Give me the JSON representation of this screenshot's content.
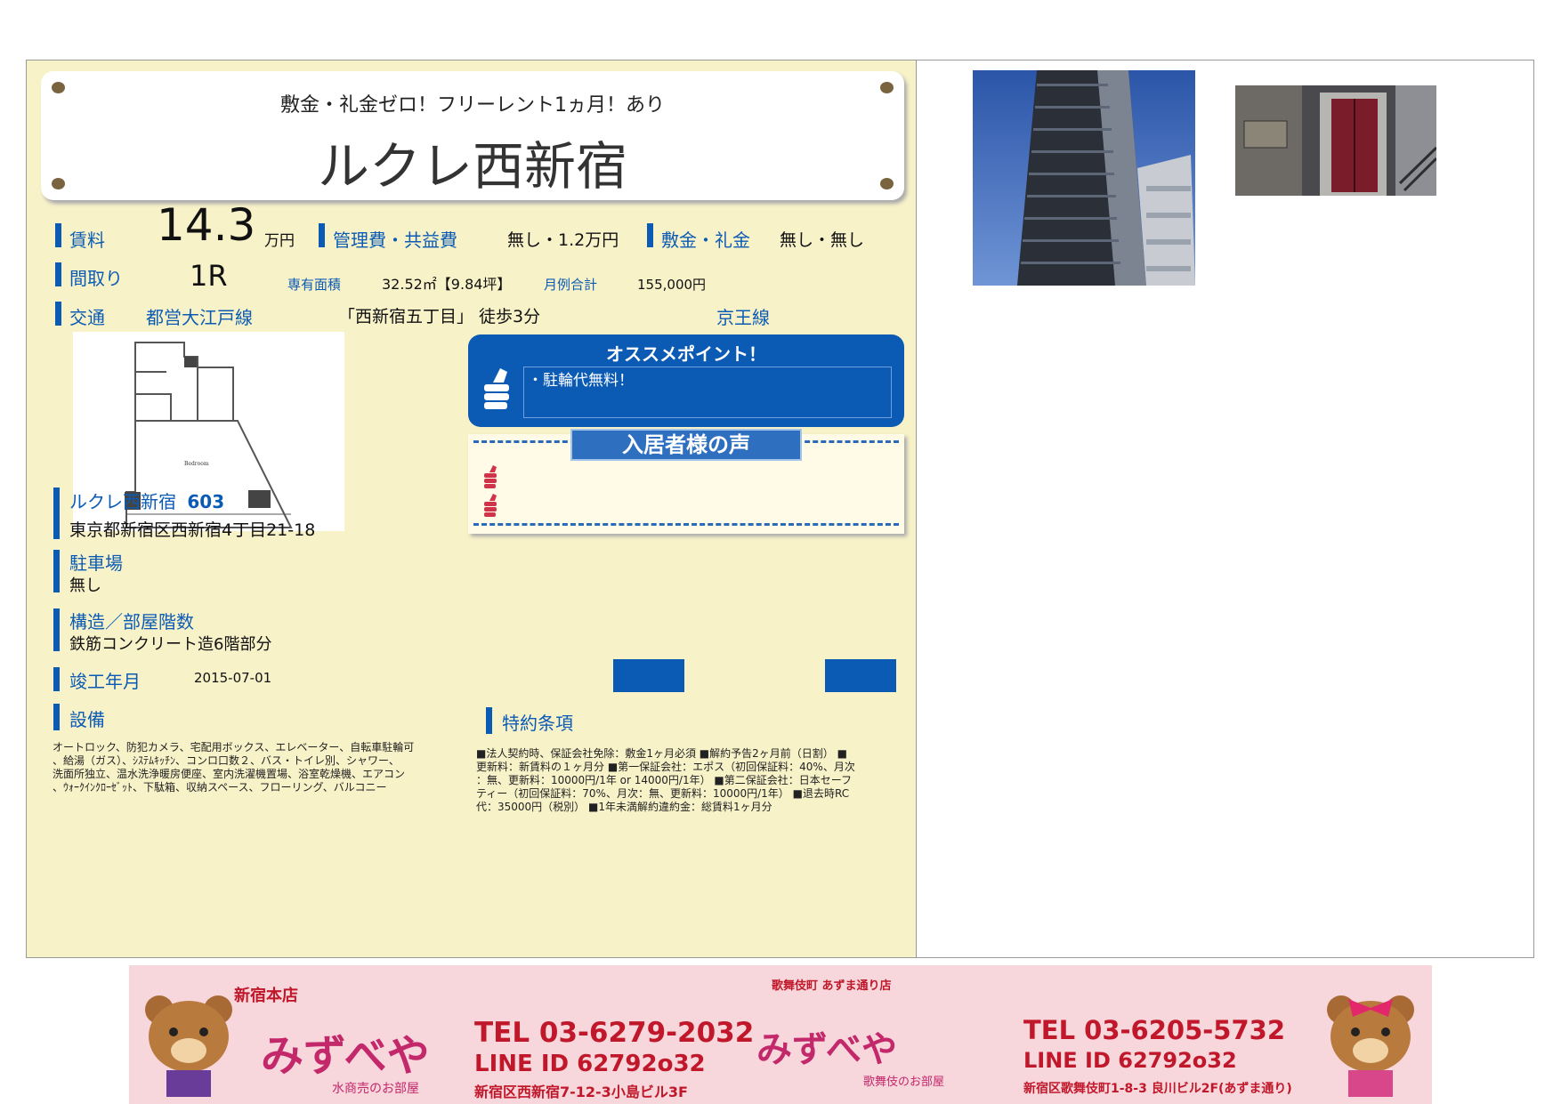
{
  "header": {
    "subtitle": "敷金・礼金ゼロ！フリーレント1ヵ月！あり",
    "title": "ルクレ西新宿"
  },
  "rent": {
    "label": "賃料",
    "value": "14.3",
    "unit": "万円",
    "mgmt_label": "管理費・共益費",
    "mgmt_value": "無し・1.2万円",
    "deposit_label": "敷金・礼金",
    "deposit_value": "無し・無し"
  },
  "layout": {
    "label": "間取り",
    "value": "1R",
    "area_label": "専有面積",
    "area_value": "32.52㎡【9.84坪】",
    "monthly_label": "月例合計",
    "monthly_value": "155,000円"
  },
  "transport": {
    "label": "交通",
    "line1": "都営大江戸線",
    "station": "「西新宿五丁目」 徒歩3分",
    "line2": "京王線"
  },
  "recommend": {
    "title": "オススメポイント！",
    "text": "・駐輪代無料！"
  },
  "voices": {
    "title": "入居者様の声"
  },
  "property": {
    "name": "ルクレ西新宿",
    "room": "603",
    "address": "東京都新宿区西新宿4丁目21-18"
  },
  "parking": {
    "label": "駐車場",
    "value": "無し"
  },
  "structure": {
    "label": "構造／部屋階数",
    "value": "鉄筋コンクリート造6階部分"
  },
  "built": {
    "label": "竣工年月",
    "value": "2015-07-01"
  },
  "equipment": {
    "label": "設備",
    "lines": [
      "オートロック、防犯カメラ、宅配用ボックス、エレベーター、自転車駐輪可",
      "、給湯（ガス）、ｼｽﾃﾑｷｯﾁﾝ、コンロ口数２、バス・トイレ別、シャワー、",
      "洗面所独立、温水洗浄暖房便座、室内洗濯機置場、浴室乾燥機、エアコン",
      "、ｳｫｰｸｲﾝｸﾛｰｾﾞｯﾄ、下駄箱、収納スペース、フローリング、バルコニー"
    ]
  },
  "terms": {
    "label": "特約条項",
    "lines": [
      "■法人契約時、保証会社免除：敷金1ヶ月必須 ■解約予告2ヶ月前（日割） ■",
      "更新料：新賃料の１ヶ月分 ■第一保証会社：エポス（初回保証料：40%、月次",
      "：無、更新料：10000円/1年 or 14000円/1年） ■第二保証会社：日本セーフ",
      "ティー（初回保証料：70%、月次：無、更新料：10000円/1年） ■退去時RC",
      "代：35000円（税別） ■1年未満解約違約金：総賃料1ヶ月分"
    ]
  },
  "floorplan": {
    "room_label": "Bedroom"
  },
  "banner": {
    "shop1": {
      "tag": "新宿本店",
      "brand": "みずべや",
      "sub": "水商売のお部屋",
      "tel": "TEL 03-6279-2032",
      "line": "LINE ID 62792o32",
      "address": "新宿区西新宿7-12-3小島ビル3F"
    },
    "shop2": {
      "tag": "歌舞伎町 あずま通り店",
      "brand": "みずべや",
      "sub": "歌舞伎のお部屋",
      "tel": "TEL 03-6205-5732",
      "line": "LINE ID 62792o32",
      "address": "新宿区歌舞伎町1-8-3 良川ビル2F(あずま通り)"
    }
  },
  "colors": {
    "accent": "#0b5bb5",
    "panel": "#f8f2c9",
    "banner": "#f7d6dc"
  }
}
